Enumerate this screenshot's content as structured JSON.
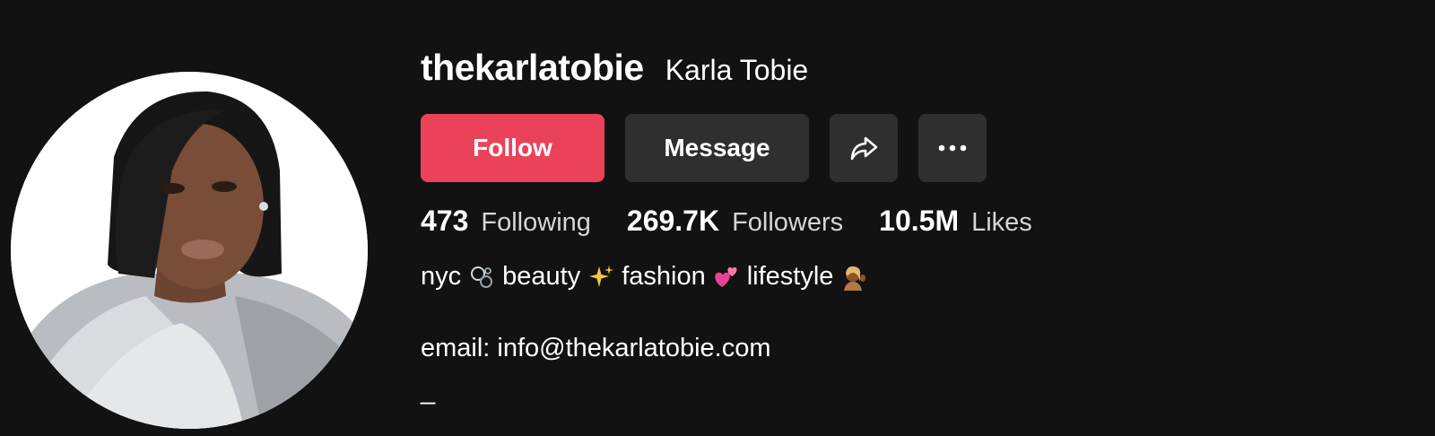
{
  "profile": {
    "username": "thekarlatobie",
    "display_name": "Karla Tobie",
    "avatar_icon": "profile-photo"
  },
  "actions": {
    "follow_label": "Follow",
    "message_label": "Message",
    "share_icon": "share-arrow-icon",
    "more_icon": "more-dots-icon"
  },
  "stats": {
    "following_count": "473",
    "following_label": "Following",
    "followers_count": "269.7K",
    "followers_label": "Followers",
    "likes_count": "10.5M",
    "likes_label": "Likes"
  },
  "bio": {
    "word1": "nyc",
    "word2": "beauty",
    "word3": "fashion",
    "word4": "lifestyle",
    "email_line": "email: info@thekarlatobie.com",
    "trailing": "_"
  },
  "colors": {
    "background": "#121212",
    "follow_button": "#ea4359",
    "secondary_button": "#2f2f2f"
  }
}
